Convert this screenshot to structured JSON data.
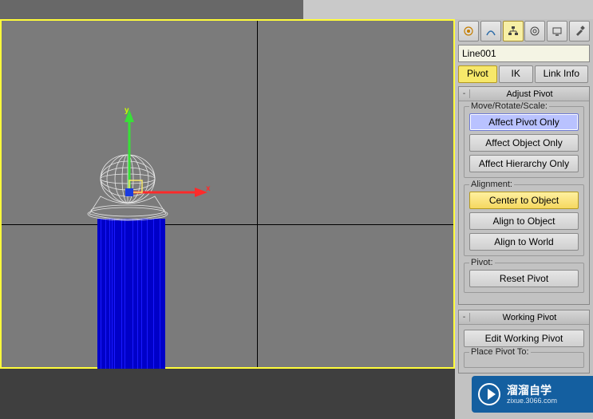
{
  "object_name": "Line001",
  "sub_tabs": {
    "pivot": "Pivot",
    "ik": "IK",
    "link": "Link Info"
  },
  "rollouts": {
    "adjust_pivot": {
      "title": "Adjust Pivot",
      "move_rotate_scale_label": "Move/Rotate/Scale:",
      "affect_pivot_only": "Affect Pivot Only",
      "affect_object_only": "Affect Object Only",
      "affect_hierarchy_only": "Affect Hierarchy Only",
      "alignment_label": "Alignment:",
      "center_to_object": "Center to Object",
      "align_to_object": "Align to Object",
      "align_to_world": "Align to World",
      "pivot_label": "Pivot:",
      "reset_pivot": "Reset Pivot"
    },
    "working_pivot": {
      "title": "Working Pivot",
      "edit_working_pivot": "Edit Working Pivot",
      "place_pivot_to": "Place Pivot To:"
    }
  },
  "gizmo": {
    "x": "x",
    "y": "y"
  },
  "watermark": {
    "line1": "溜溜自学",
    "line2": "zixue.3066.com"
  },
  "rollout_toggle": "-"
}
